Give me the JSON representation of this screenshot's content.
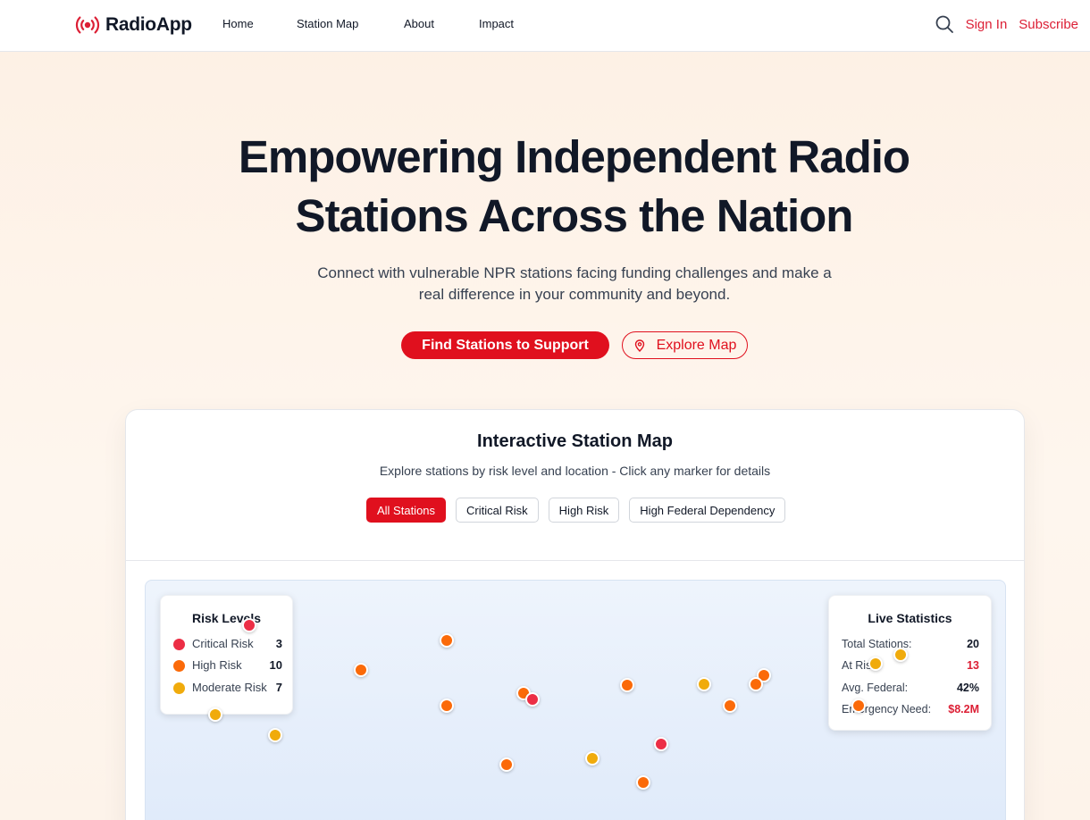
{
  "nav": {
    "brand": "RadioApp",
    "brand_icon": "radio-broadcast-icon",
    "brand_color": "#dc1f35",
    "links": [
      "Home",
      "Station Map",
      "About",
      "Impact"
    ],
    "search_icon": "search-icon",
    "sign_in": "Sign In",
    "subscribe": "Subscribe"
  },
  "hero": {
    "title_line1": "Empowering Independent Radio",
    "title_line2": "Stations Across the Nation",
    "subtitle": "Connect with vulnerable NPR stations facing funding challenges and make a real difference in your community and beyond.",
    "primary_button": "Find Stations to Support",
    "secondary_button": "Explore Map",
    "secondary_icon": "map-pin-icon"
  },
  "map_section": {
    "title": "Interactive Station Map",
    "subtitle": "Explore stations by risk level and location - Click any marker for details",
    "filters": [
      "All Stations",
      "Critical Risk",
      "High Risk",
      "High Federal Dependency"
    ],
    "active_filter": "All Stations",
    "legend": {
      "title": "Risk Levels",
      "items": [
        {
          "label": "Critical Risk",
          "count": "3",
          "color": "#ec2e45"
        },
        {
          "label": "High Risk",
          "count": "10",
          "color": "#fb6a09"
        },
        {
          "label": "Moderate Risk",
          "count": "7",
          "color": "#f0ab0c"
        }
      ]
    },
    "stats": {
      "title": "Live Statistics",
      "rows": [
        {
          "label": "Total Stations:",
          "value": "20",
          "color": "#111827"
        },
        {
          "label": "At Risk:",
          "value": "13",
          "color": "#dc1f35"
        },
        {
          "label": "Avg. Federal:",
          "value": "42%",
          "color": "#111827"
        },
        {
          "label": "Emergency Need:",
          "value": "$8.2M",
          "color": "#dc1f35"
        }
      ]
    },
    "marker_levels": [
      "critical",
      "high",
      "high",
      "high",
      "high",
      "high",
      "critical",
      "high",
      "moderate",
      "high",
      "high",
      "high",
      "moderate",
      "moderate",
      "moderate",
      "moderate",
      "high",
      "moderate",
      "critical",
      "high"
    ]
  }
}
